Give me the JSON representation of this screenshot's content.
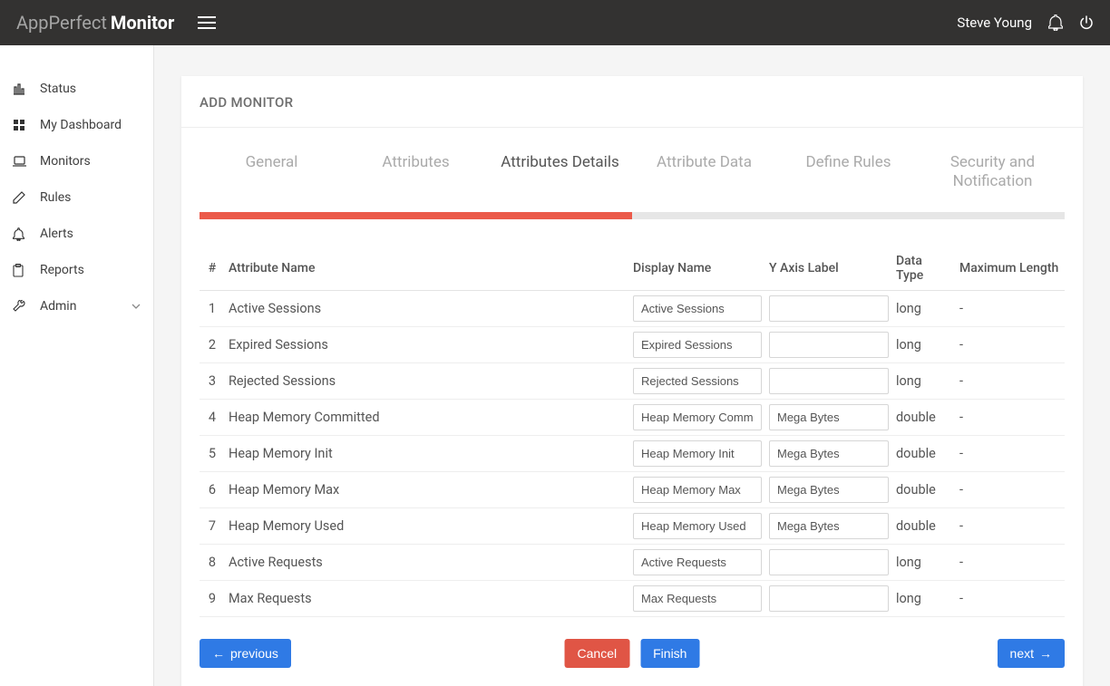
{
  "header": {
    "brand_light": "AppPerfect",
    "brand_bold": "Monitor",
    "user": "Steve Young"
  },
  "sidebar": {
    "items": [
      {
        "label": "Status",
        "icon": "bar-chart-icon"
      },
      {
        "label": "My Dashboard",
        "icon": "grid-icon"
      },
      {
        "label": "Monitors",
        "icon": "laptop-icon"
      },
      {
        "label": "Rules",
        "icon": "pencil-icon"
      },
      {
        "label": "Alerts",
        "icon": "bell-icon"
      },
      {
        "label": "Reports",
        "icon": "clipboard-icon"
      },
      {
        "label": "Admin",
        "icon": "wrench-icon",
        "expandable": true
      }
    ]
  },
  "card": {
    "title": "ADD MONITOR",
    "tabs": [
      {
        "label": "General"
      },
      {
        "label": "Attributes"
      },
      {
        "label": "Attributes Details",
        "active": true
      },
      {
        "label": "Attribute Data"
      },
      {
        "label": "Define Rules"
      },
      {
        "label": "Security and Notification",
        "multi": true
      }
    ],
    "progress_percent": 50,
    "table": {
      "headers": {
        "num": "#",
        "attr_name": "Attribute Name",
        "display_name": "Display Name",
        "y_axis": "Y Axis Label",
        "data_type": "Data Type",
        "max_len": "Maximum Length"
      },
      "rows": [
        {
          "n": "1",
          "name": "Active Sessions",
          "display": "Active Sessions",
          "yaxis": "",
          "dtype": "long",
          "maxlen": "-"
        },
        {
          "n": "2",
          "name": "Expired Sessions",
          "display": "Expired Sessions",
          "yaxis": "",
          "dtype": "long",
          "maxlen": "-"
        },
        {
          "n": "3",
          "name": "Rejected Sessions",
          "display": "Rejected Sessions",
          "yaxis": "",
          "dtype": "long",
          "maxlen": "-"
        },
        {
          "n": "4",
          "name": "Heap Memory Committed",
          "display": "Heap Memory Comm",
          "yaxis": "Mega Bytes",
          "dtype": "double",
          "maxlen": "-"
        },
        {
          "n": "5",
          "name": "Heap Memory Init",
          "display": "Heap Memory Init",
          "yaxis": "Mega Bytes",
          "dtype": "double",
          "maxlen": "-"
        },
        {
          "n": "6",
          "name": "Heap Memory Max",
          "display": "Heap Memory Max",
          "yaxis": "Mega Bytes",
          "dtype": "double",
          "maxlen": "-"
        },
        {
          "n": "7",
          "name": "Heap Memory Used",
          "display": "Heap Memory Used",
          "yaxis": "Mega Bytes",
          "dtype": "double",
          "maxlen": "-"
        },
        {
          "n": "8",
          "name": "Active Requests",
          "display": "Active Requests",
          "yaxis": "",
          "dtype": "long",
          "maxlen": "-"
        },
        {
          "n": "9",
          "name": "Max Requests",
          "display": "Max Requests",
          "yaxis": "",
          "dtype": "long",
          "maxlen": "-"
        }
      ]
    },
    "buttons": {
      "previous": "previous",
      "cancel": "Cancel",
      "finish": "Finish",
      "next": "next"
    }
  }
}
